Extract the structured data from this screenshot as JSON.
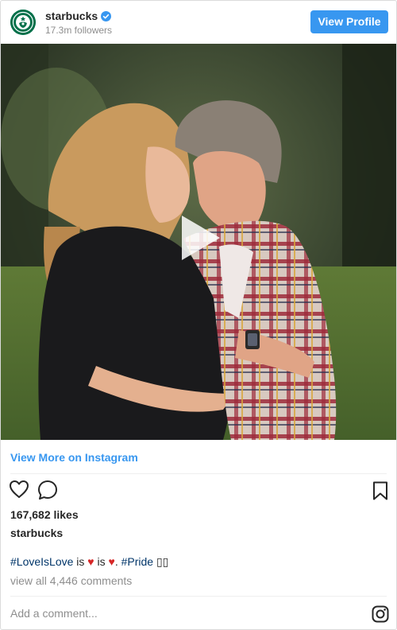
{
  "header": {
    "username": "starbucks",
    "followers": "17.3m followers",
    "view_profile_label": "View Profile",
    "avatar_icon": "starbucks-siren-logo",
    "verified_icon": "verified-badge-icon"
  },
  "media": {
    "type": "video",
    "play_icon": "play-icon"
  },
  "view_more_label": "View More on Instagram",
  "actions": {
    "like_icon": "heart-outline-icon",
    "comment_icon": "comment-bubble-icon",
    "save_icon": "bookmark-icon"
  },
  "likes": "167,682 likes",
  "author": "starbucks",
  "caption": {
    "hashtag1": "#LoveIsLove",
    "text1": " is ",
    "heart1": "♥",
    "text2": " is ",
    "heart2": "♥",
    "text3": ". ",
    "hashtag2": "#Pride",
    "trailing": " ▯▯"
  },
  "comments_link": "view all 4,446 comments",
  "comment_placeholder": "Add a comment...",
  "footer_icon": "instagram-icon",
  "colors": {
    "accent": "#3897f0",
    "hashtag": "#003569",
    "heart": "#d62626",
    "muted": "#8e8e8e",
    "brand": "#00704a"
  }
}
